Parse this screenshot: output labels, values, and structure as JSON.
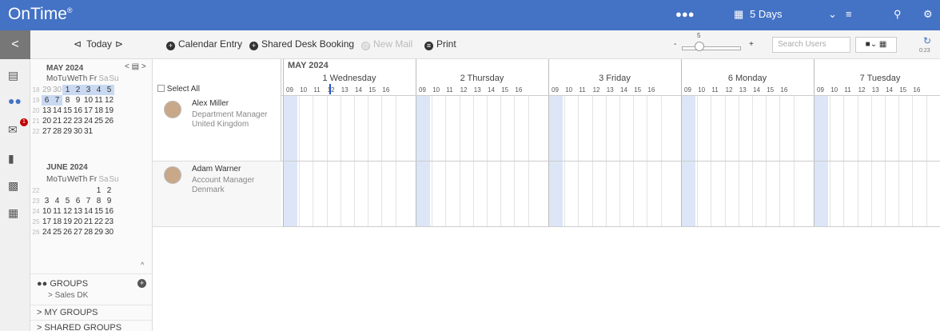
{
  "app": {
    "logo": "OnTime",
    "logo_mark": "®"
  },
  "topbar": {
    "days_label": "5 Days",
    "chevron": "⌄"
  },
  "toolbar": {
    "back": "<",
    "prev": "⊲",
    "today": "Today",
    "next": "⊳",
    "calendar_entry": "Calendar Entry",
    "shared_desk": "Shared Desk Booking",
    "new_mail": "New Mail",
    "print": "Print",
    "zoom_value": "5",
    "zoom_minus": "-",
    "zoom_plus": "+",
    "search_placeholder": "Search Users",
    "refresh_time": "0:23"
  },
  "nav": {
    "mail_badge": "1"
  },
  "calendar": {
    "may_title": "MAY 2024",
    "june_title": "JUNE 2024",
    "weekdays": [
      "Mo",
      "Tu",
      "We",
      "Th",
      "Fr",
      "Sa",
      "Su"
    ],
    "may_weeks": [
      {
        "wk": "18",
        "days": [
          "29",
          "30",
          "1",
          "2",
          "3",
          "4",
          "5"
        ]
      },
      {
        "wk": "19",
        "days": [
          "6",
          "7",
          "8",
          "9",
          "10",
          "11",
          "12"
        ]
      },
      {
        "wk": "20",
        "days": [
          "13",
          "14",
          "15",
          "16",
          "17",
          "18",
          "19"
        ]
      },
      {
        "wk": "21",
        "days": [
          "20",
          "21",
          "22",
          "23",
          "24",
          "25",
          "26"
        ]
      },
      {
        "wk": "22",
        "days": [
          "27",
          "28",
          "29",
          "30",
          "31",
          "",
          ""
        ]
      }
    ],
    "june_weeks": [
      {
        "wk": "22",
        "days": [
          "",
          "",
          "",
          "",
          "",
          "1",
          "2"
        ]
      },
      {
        "wk": "23",
        "days": [
          "3",
          "4",
          "5",
          "6",
          "7",
          "8",
          "9"
        ]
      },
      {
        "wk": "24",
        "days": [
          "10",
          "11",
          "12",
          "13",
          "14",
          "15",
          "16"
        ]
      },
      {
        "wk": "25",
        "days": [
          "17",
          "18",
          "19",
          "20",
          "21",
          "22",
          "23"
        ]
      },
      {
        "wk": "26",
        "days": [
          "24",
          "25",
          "26",
          "27",
          "28",
          "29",
          "30"
        ]
      }
    ]
  },
  "groups": {
    "title": "GROUPS",
    "current": "> Sales DK",
    "my_groups": "> MY GROUPS",
    "shared_groups": "> SHARED GROUPS"
  },
  "schedule": {
    "month": "MAY 2024",
    "select_all": "Select All",
    "days": [
      {
        "label": "1 Wednesday"
      },
      {
        "label": "2 Thursday"
      },
      {
        "label": "3 Friday"
      },
      {
        "label": "6 Monday"
      },
      {
        "label": "7 Tuesday"
      }
    ],
    "hours": [
      "09",
      "10",
      "11",
      "12",
      "13",
      "14",
      "15",
      "16"
    ]
  },
  "people": [
    {
      "name": "Alex Miller",
      "title": "Department Manager",
      "country": "United Kingdom"
    },
    {
      "name": "Adam Warner",
      "title": "Account Manager",
      "country": "Denmark"
    }
  ],
  "colors": {
    "brand": "#4472c4",
    "highlight": "#dce6f7",
    "badge": "#c00000"
  }
}
